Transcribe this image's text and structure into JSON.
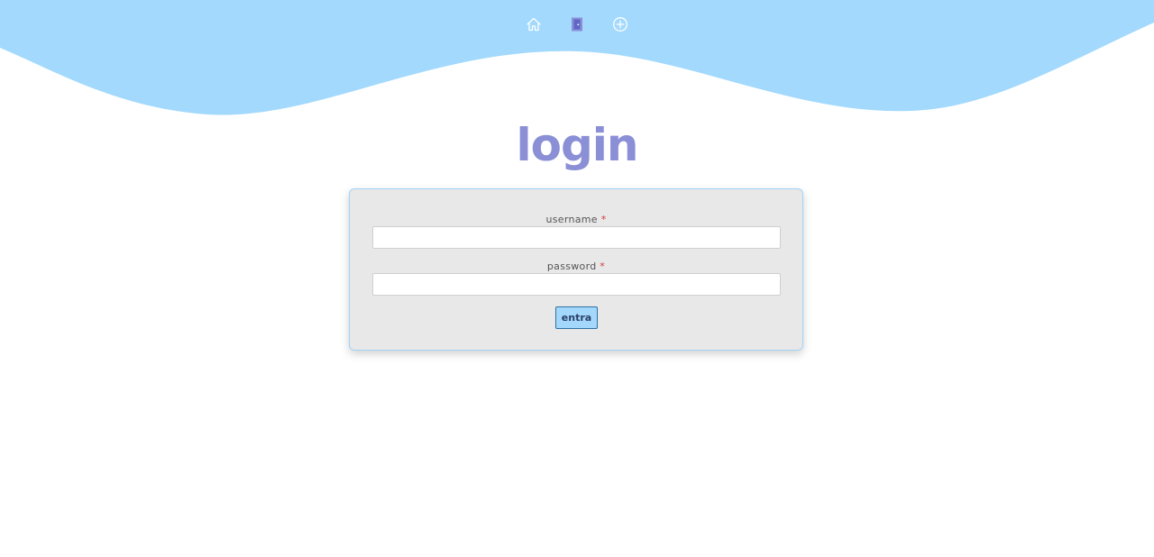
{
  "colors": {
    "wave": "#a2d9fd",
    "title": "#8a8fd6",
    "card_bg": "#e8e8e8",
    "card_border": "#9fd4f7",
    "button_bg": "#a3d8fc",
    "required": "#d23a3a"
  },
  "nav": {
    "items": [
      {
        "icon": "home-icon"
      },
      {
        "icon": "door-icon"
      },
      {
        "icon": "plus-circle-icon"
      }
    ]
  },
  "page": {
    "title": "login"
  },
  "form": {
    "username_label": "username",
    "password_label": "password",
    "required_mark": "*",
    "username_value": "",
    "password_value": "",
    "submit_label": "entra"
  }
}
